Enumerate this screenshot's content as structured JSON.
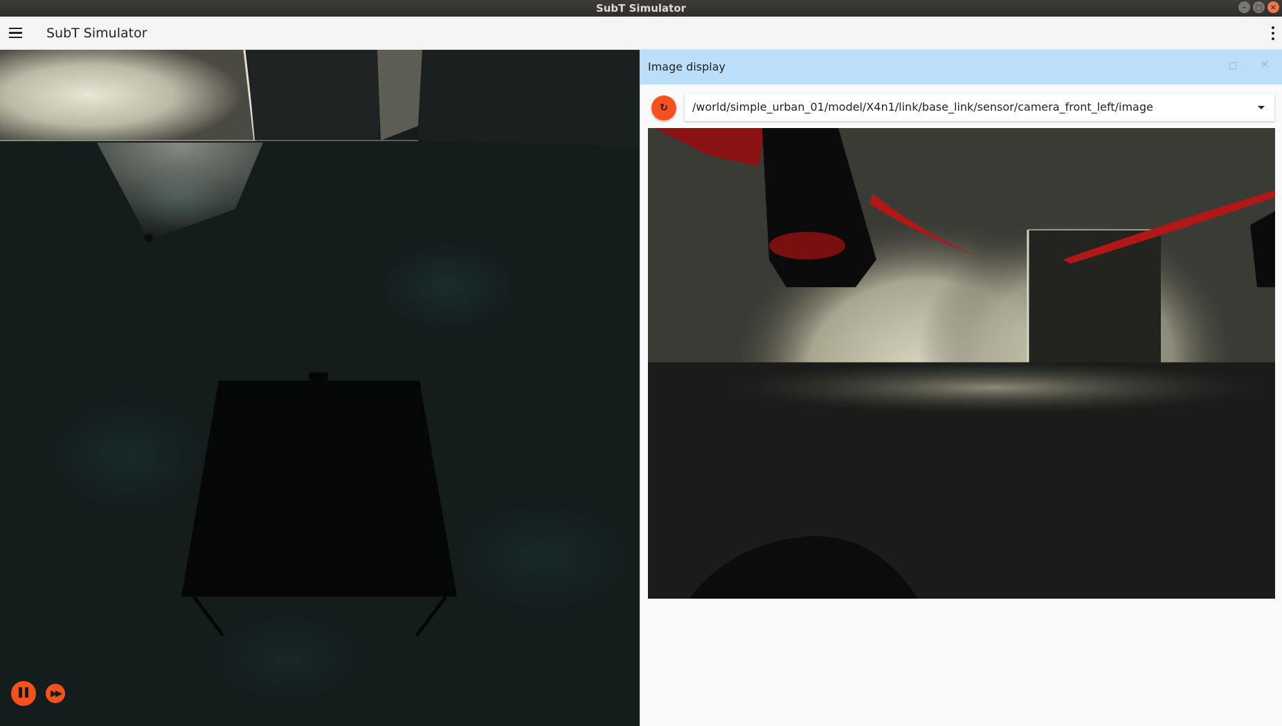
{
  "window": {
    "title": "SubT Simulator",
    "controls": [
      "minimize",
      "maximize",
      "close"
    ]
  },
  "appbar": {
    "title": "SubT Simulator",
    "menu_icon": "hamburger-menu-icon",
    "overflow_icon": "more-vert-icon"
  },
  "scene": {
    "controls": {
      "play_pause_icon": "pause-icon",
      "step_icon": "fast-forward-icon"
    }
  },
  "image_display": {
    "title": "Image display",
    "refresh_icon": "refresh-icon",
    "topic": "/world/simple_urban_01/model/X4n1/link/base_link/sensor/camera_front_left/image",
    "dropdown_icon": "arrow-drop-down-icon"
  },
  "colors": {
    "accent": "#f4511e",
    "panel_header": "#bbdefb",
    "titlebar": "#3c3b37"
  }
}
